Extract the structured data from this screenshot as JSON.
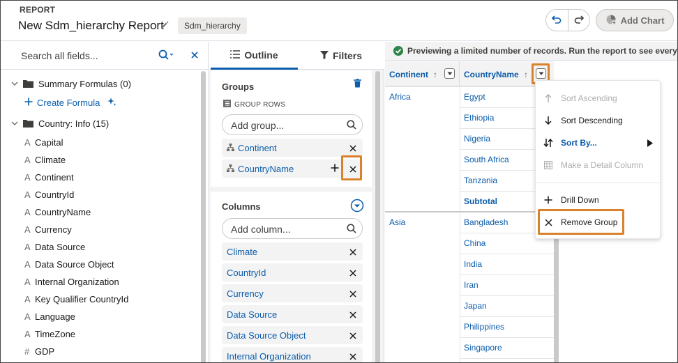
{
  "header": {
    "eyebrow": "REPORT",
    "title": "New Sdm_hierarchy Report",
    "type_badge": "Sdm_hierarchy",
    "add_chart_label": "Add Chart"
  },
  "fields_panel": {
    "search_placeholder": "Search all fields...",
    "folders": [
      {
        "label": "Summary Formulas (0)"
      },
      {
        "label": "Country: Info (15)"
      }
    ],
    "create_formula_label": "Create Formula",
    "items": [
      {
        "type_glyph": "A",
        "label": "Capital"
      },
      {
        "type_glyph": "A",
        "label": "Climate"
      },
      {
        "type_glyph": "A",
        "label": "Continent"
      },
      {
        "type_glyph": "A",
        "label": "CountryId"
      },
      {
        "type_glyph": "A",
        "label": "CountryName"
      },
      {
        "type_glyph": "A",
        "label": "Currency"
      },
      {
        "type_glyph": "A",
        "label": "Data Source"
      },
      {
        "type_glyph": "A",
        "label": "Data Source Object"
      },
      {
        "type_glyph": "A",
        "label": "Internal Organization"
      },
      {
        "type_glyph": "A",
        "label": "Key Qualifier CountryId"
      },
      {
        "type_glyph": "A",
        "label": "Language"
      },
      {
        "type_glyph": "A",
        "label": "TimeZone"
      },
      {
        "type_glyph": "#",
        "label": "GDP"
      }
    ]
  },
  "outline_panel": {
    "tabs": [
      {
        "label": "Outline"
      },
      {
        "label": "Filters"
      }
    ],
    "groups": {
      "title": "Groups",
      "subtitle": "GROUP ROWS",
      "placeholder": "Add group...",
      "chips": [
        {
          "label": "Continent"
        },
        {
          "label": "CountryName"
        }
      ]
    },
    "columns": {
      "title": "Columns",
      "placeholder": "Add column...",
      "chips": [
        {
          "label": "Climate"
        },
        {
          "label": "CountryId"
        },
        {
          "label": "Currency"
        },
        {
          "label": "Data Source"
        },
        {
          "label": "Data Source Object"
        },
        {
          "label": "Internal Organization"
        }
      ]
    }
  },
  "preview": {
    "banner": "Previewing a limited number of records. Run the report to see everything.",
    "columns": [
      {
        "label": "Continent",
        "sort": "↑"
      },
      {
        "label": "CountryName",
        "sort": "↑"
      }
    ],
    "groups": [
      {
        "continent": "Africa",
        "countries": [
          "Egypt",
          "Ethiopia",
          "Nigeria",
          "South Africa",
          "Tanzania"
        ],
        "subtotal": "Subtotal"
      },
      {
        "continent": "Asia",
        "countries": [
          "Bangladesh",
          "China",
          "India",
          "Iran",
          "Japan",
          "Philippines",
          "Singapore"
        ]
      }
    ]
  },
  "column_menu": {
    "items": [
      {
        "label": "Sort Ascending",
        "state": "disabled"
      },
      {
        "label": "Sort Descending",
        "state": "normal"
      },
      {
        "label": "Sort By...",
        "state": "submenu"
      },
      {
        "label": "Make a Detail Column",
        "state": "disabled"
      },
      {
        "label": "Drill Down",
        "state": "normal"
      },
      {
        "label": "Remove Group",
        "state": "highlighted"
      }
    ]
  },
  "colors": {
    "brand": "#0b5cab",
    "highlight": "#d9822b",
    "success": "#2e844a"
  }
}
